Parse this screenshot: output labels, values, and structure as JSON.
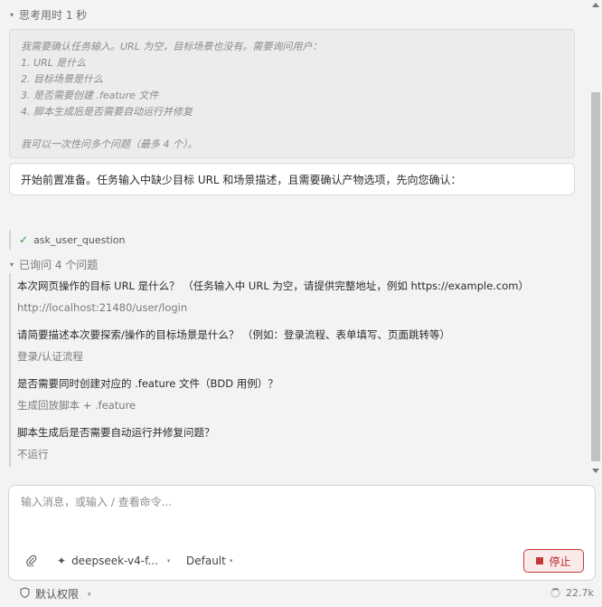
{
  "thinking": {
    "header": "思考用时 1 秒",
    "lines": [
      "我需要确认任务输入。URL 为空，目标场景也没有。需要询问用户：",
      "1. URL 是什么",
      "2. 目标场景是什么",
      "3. 是否需要创建 .feature 文件",
      "4. 脚本生成后是否需要自动运行并修复"
    ],
    "final_line": "我可以一次性问多个问题（最多 4 个）。"
  },
  "answer": {
    "text": "开始前置准备。任务输入中缺少目标 URL 和场景描述，且需要确认产物选项，先向您确认："
  },
  "tool_call": {
    "name": "ask_user_question"
  },
  "asked": {
    "header": "已询问 4 个问题",
    "items": [
      {
        "q": "本次网页操作的目标 URL 是什么？ （任务输入中 URL 为空，请提供完整地址，例如 https://example.com）",
        "a": "http://localhost:21480/user/login"
      },
      {
        "q": "请简要描述本次要探索/操作的目标场景是什么？ （例如：登录流程、表单填写、页面跳转等）",
        "a": "登录/认证流程"
      },
      {
        "q": "是否需要同时创建对应的 .feature 文件（BDD 用例）？",
        "a": "生成回放脚本 + .feature"
      },
      {
        "q": "脚本生成后是否需要自动运行并修复问题？",
        "a": "不运行"
      }
    ]
  },
  "composer": {
    "placeholder": "输入消息，或输入 / 查看命令...",
    "model": "deepseek-v4-f...",
    "mode": "Default",
    "stop_label": "停止"
  },
  "footer": {
    "permission": "默认权限",
    "token_count": "22.7k"
  },
  "colors": {
    "stop_accent": "#c33a3a",
    "check": "#3c9a3c"
  }
}
